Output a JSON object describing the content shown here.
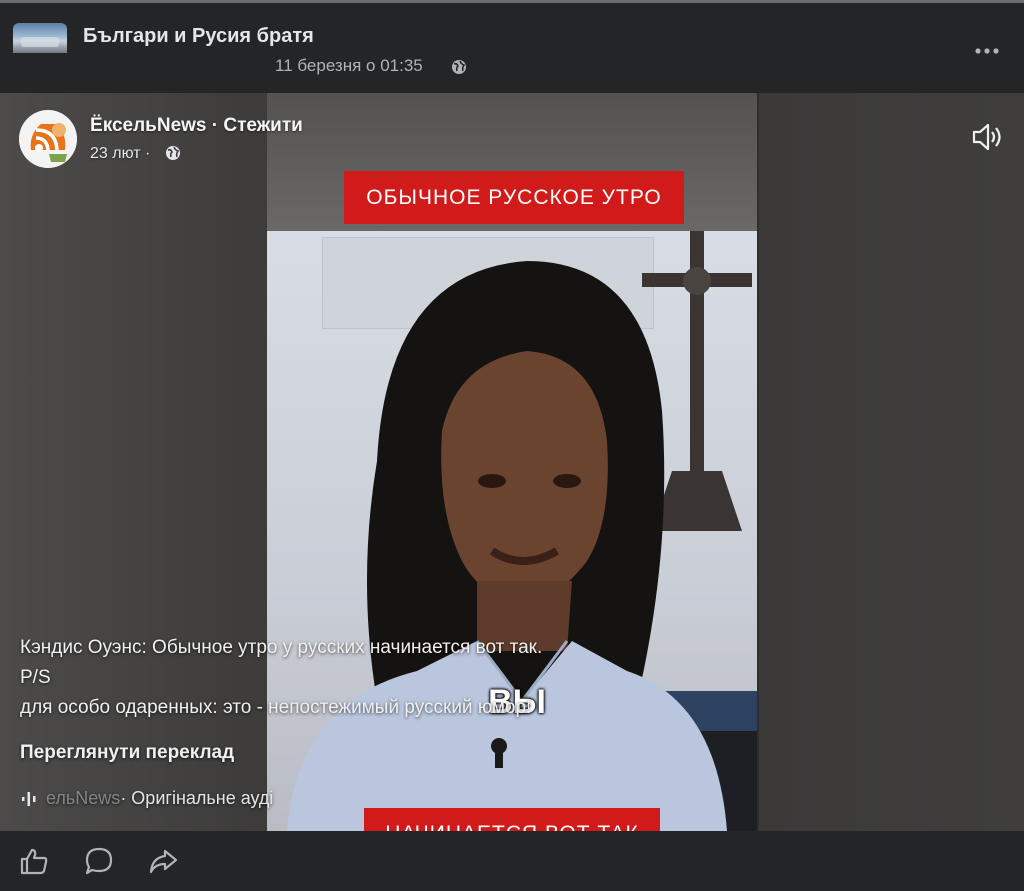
{
  "group": {
    "name": "Българи и Русия братя",
    "date": "11 березня о 01:35"
  },
  "post": {
    "page_name": "ЁксельNews · Стежити",
    "page_date": "23 лют ·",
    "video": {
      "caption_top": "ОБЫЧНОЕ РУССКОЕ УТРО",
      "caption_mid": "ВЫ",
      "caption_bottom": "НАЧИНАЕТСЯ ВОТ ТАК"
    },
    "description": [
      "Кэндис Оуэнс: Обычное утро у русских начинается вот так.",
      "P/S",
      "для особо одаренных: это - непостежимый русский юмор!"
    ],
    "translate_label": "Переглянути переклад",
    "audio": {
      "name_faded": "ельNews",
      "name_rest": " · Оригінальне ауді"
    }
  },
  "icons": {
    "privacy": "globe-icon",
    "menu": "more-horizontal-icon",
    "sound": "volume-icon",
    "audio": "audio-wave-icon",
    "like": "thumbs-up-icon",
    "comment": "comment-icon",
    "share": "share-icon"
  },
  "colors": {
    "background": "#242526",
    "text": "#e4e6eb",
    "secondary_text": "#b0b3b8",
    "caption_red": "#d11a1a"
  }
}
